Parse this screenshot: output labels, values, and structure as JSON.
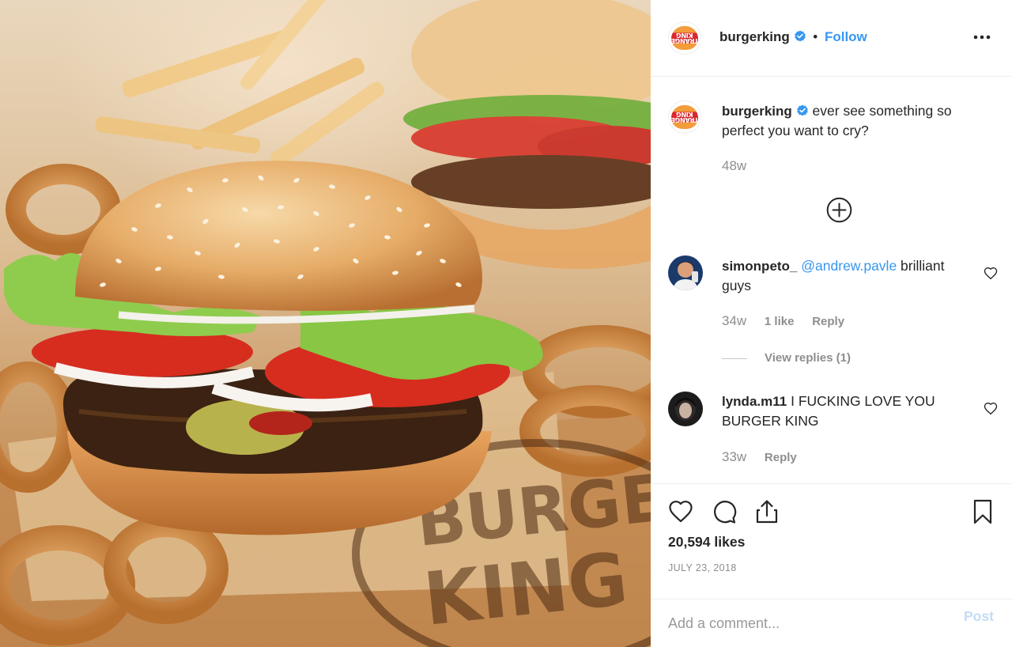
{
  "post": {
    "username": "burgerking",
    "follow_label": "Follow",
    "more_label": "More options",
    "avatar_text": "STRANGER KING",
    "caption": {
      "username": "burgerking",
      "text": "ever see something so perfect you want to cry?",
      "age": "48w"
    },
    "comments": [
      {
        "username": "simonpeto_",
        "mention": "@andrew.pavle",
        "text": " brilliant guys",
        "age": "34w",
        "likes": "1 like",
        "reply_label": "Reply",
        "view_replies": "View replies (1)"
      },
      {
        "username": "lynda.m11",
        "text": "I FUCKING LOVE YOU BURGER KING",
        "age": "33w",
        "reply_label": "Reply"
      }
    ],
    "likes": "20,594 likes",
    "date": "JULY 23, 2018",
    "add_comment_placeholder": "Add a comment...",
    "post_button": "Post",
    "photo_text": "BURGER KING"
  },
  "colors": {
    "accent": "#3897f0",
    "muted": "#8e8e8e",
    "text": "#262626",
    "post_disabled": "#c3dcf6"
  },
  "icons": [
    "verified-badge-icon",
    "more-icon",
    "add-icon",
    "heart-icon",
    "comment-icon",
    "share-icon",
    "bookmark-icon"
  ]
}
